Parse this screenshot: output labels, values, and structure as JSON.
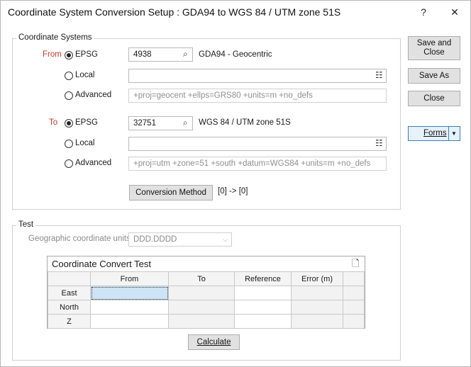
{
  "window": {
    "title": "Coordinate System Conversion Setup : GDA94 to WGS 84 / UTM zone 51S",
    "help_label": "?",
    "close_label": "✕"
  },
  "coordinate_systems": {
    "group_label": "Coordinate Systems",
    "from": {
      "label": "From",
      "epsg_label": "EPSG",
      "epsg_code": "4938",
      "epsg_name": "GDA94 - Geocentric",
      "local_label": "Local",
      "local_value": "",
      "advanced_label": "Advanced",
      "advanced_value": "+proj=geocent +ellps=GRS80 +units=m +no_defs",
      "selected": "EPSG"
    },
    "to": {
      "label": "To",
      "epsg_label": "EPSG",
      "epsg_code": "32751",
      "epsg_name": "WGS 84 / UTM zone 51S",
      "local_label": "Local",
      "local_value": "",
      "advanced_label": "Advanced",
      "advanced_value": "+proj=utm +zone=51 +south +datum=WGS84 +units=m +no_defs",
      "selected": "EPSG"
    },
    "conversion_method_label": "Conversion Method",
    "conversion_method_value": "[0] -> [0]"
  },
  "buttons": {
    "save_and_close_line1": "Save and",
    "save_and_close_line2": "Close",
    "save_as": "Save As",
    "close": "Close",
    "forms": "Forms",
    "forms_dropdown": "▼"
  },
  "test": {
    "group_label": "Test",
    "geo_units_label": "Geographic coordinate units",
    "geo_units_value": "DDD.DDDD",
    "grid_title": "Coordinate Convert Test",
    "columns": [
      "From",
      "To",
      "Reference",
      "Error (m)"
    ],
    "rows": [
      {
        "label": "East",
        "cells": [
          "",
          "",
          "",
          ""
        ]
      },
      {
        "label": "North",
        "cells": [
          "",
          "",
          "",
          ""
        ]
      },
      {
        "label": "Z",
        "cells": [
          "",
          "",
          "",
          ""
        ]
      }
    ],
    "calculate_label": "Calculate"
  },
  "colors": {
    "accent": "#3c7fb1",
    "selected_cell": "#cfe3f7",
    "from_to_label": "#c0392b"
  }
}
